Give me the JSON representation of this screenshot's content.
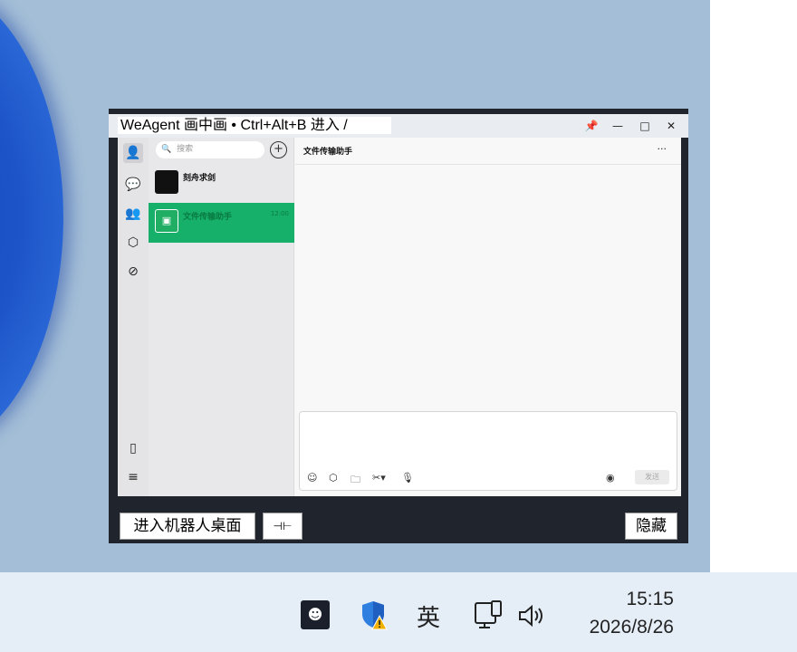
{
  "pip_window": {
    "title": "WeAgent 画中画 • Ctrl+Alt+B 进入 /",
    "controls": {
      "pin": "📌",
      "minimize": "—",
      "maximize": "□",
      "close": "✕"
    },
    "bottom_bar": {
      "enter_desktop_label": "进入机器人桌面",
      "pin_label": "⊣⊢",
      "hide_label": "隐藏"
    }
  },
  "wechat": {
    "search_placeholder": "搜索",
    "search_icon": "🔍",
    "add_icon": "+",
    "sidebar_icons": [
      "user-avatar-icon",
      "chat-icon",
      "contacts-icon",
      "cube-icon",
      "compass-icon",
      "phone-icon",
      "menu-icon"
    ],
    "chats": [
      {
        "name": "刻舟求剑",
        "time": "",
        "active": false
      },
      {
        "name": "文件传输助手",
        "time": "12:00",
        "active": true
      }
    ],
    "main_title": "文件传输助手",
    "more_icon": "···",
    "send_label": "发送",
    "accent_color": "#16b06a"
  },
  "taskbar": {
    "ime_label": "英",
    "clock_time": "15:15",
    "clock_date": "2026/8/26"
  }
}
